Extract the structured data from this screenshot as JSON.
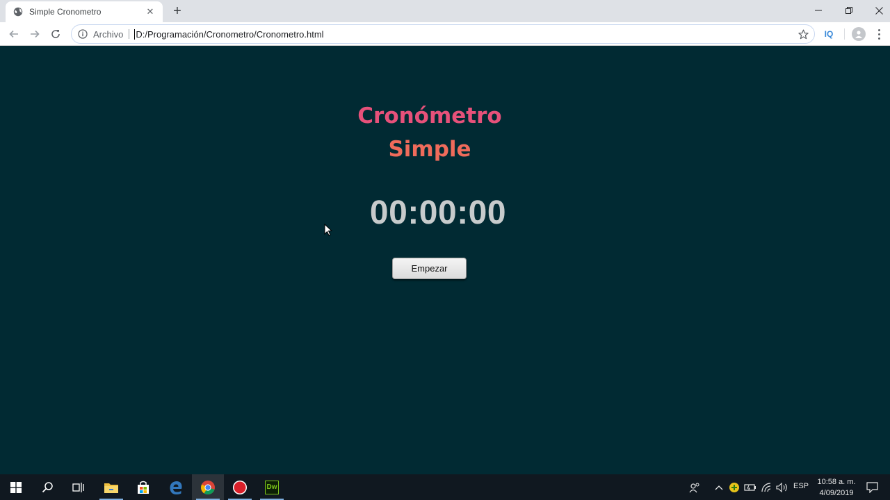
{
  "browser": {
    "tab": {
      "title": "Simple Cronometro",
      "favicon": "globe-icon"
    },
    "omnibox": {
      "scheme_label": "Archivo",
      "url": "D:/Programación/Cronometro/Cronometro.html"
    },
    "extension_label": "IQ"
  },
  "page": {
    "title_line1": "Cronómetro",
    "title_line2": "Simple",
    "timer": "00:00:00",
    "start_button": "Empezar",
    "colors": {
      "background": "#012a33",
      "title_line1": "#e6517a",
      "title_line2": "#ef6b5b",
      "timer": "#c7cbcc"
    }
  },
  "taskbar": {
    "apps": [
      "start-icon",
      "search-icon",
      "task-view-icon",
      "file-explorer-icon",
      "store-icon",
      "edge-icon",
      "chrome-icon",
      "record-icon",
      "dreamweaver-icon"
    ],
    "dreamweaver_label": "Dw",
    "language": "ESP",
    "time": "10:58 a. m.",
    "date": "4/09/2019"
  }
}
